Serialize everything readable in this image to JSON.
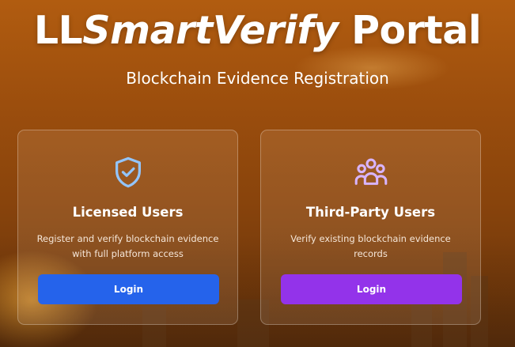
{
  "header": {
    "title_prefix": "LL",
    "title_italic": "SmartVerify",
    "title_suffix": " Portal",
    "subtitle": "Blockchain Evidence Registration"
  },
  "cards": [
    {
      "icon": "shield-check-icon",
      "title": "Licensed Users",
      "description": "Register and verify blockchain evidence with full platform access",
      "button_label": "Login",
      "button_color": "#2563eb",
      "icon_color": "#93c5fd"
    },
    {
      "icon": "users-group-icon",
      "title": "Third-Party Users",
      "description": "Verify existing blockchain evidence records",
      "button_label": "Login",
      "button_color": "#9333ea",
      "icon_color": "#d8b4fe"
    }
  ]
}
